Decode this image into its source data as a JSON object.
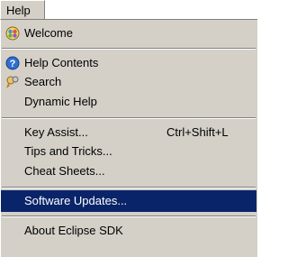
{
  "menubar": {
    "title": "Help"
  },
  "menu": {
    "welcome": {
      "label": "Welcome",
      "icon": "welcome-icon"
    },
    "help_contents": {
      "label": "Help Contents",
      "icon": "help-icon"
    },
    "search": {
      "label": "Search",
      "icon": "search-icon"
    },
    "dynamic_help": {
      "label": "Dynamic Help"
    },
    "key_assist": {
      "label": "Key Assist...",
      "accelerator": "Ctrl+Shift+L"
    },
    "tips_and_tricks": {
      "label": "Tips and Tricks..."
    },
    "cheat_sheets": {
      "label": "Cheat Sheets..."
    },
    "software_updates": {
      "label": "Software Updates...",
      "selected": true
    },
    "about": {
      "label": "About Eclipse SDK"
    }
  },
  "colors": {
    "menu_background": "#d4d0c8",
    "selection_background": "#0a246a",
    "selection_text": "#ffffff"
  }
}
